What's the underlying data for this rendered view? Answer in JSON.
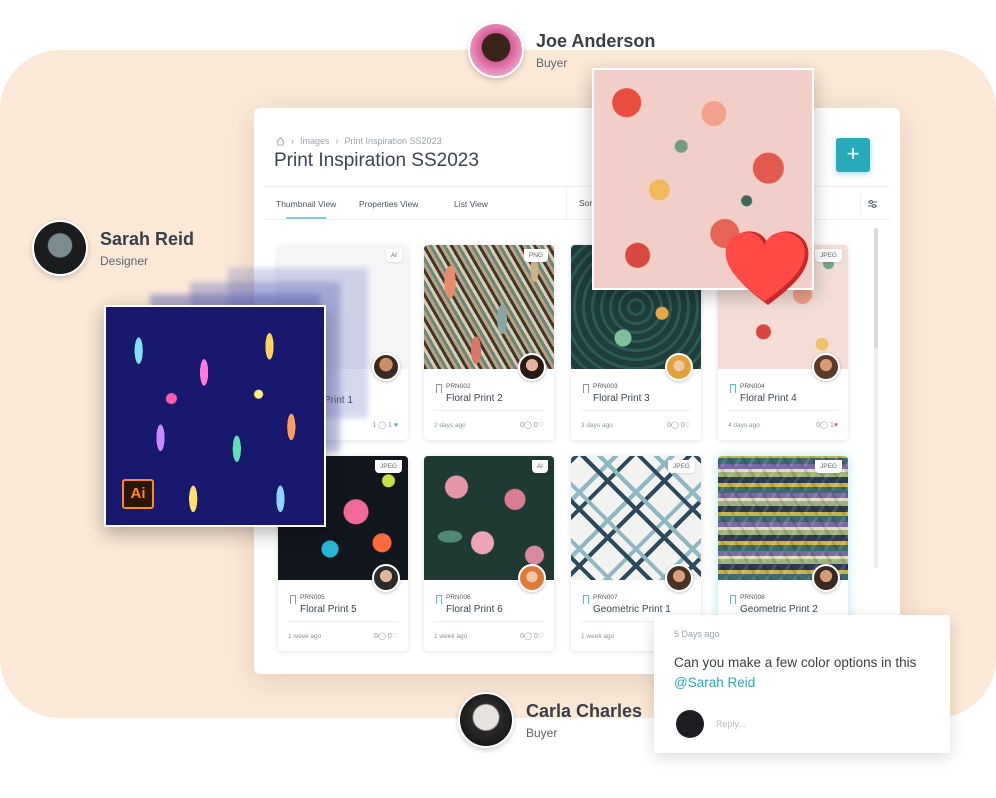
{
  "app": {
    "breadcrumb": [
      "Images",
      "Print Inspiration SS2023"
    ],
    "title": "Print Inspiration SS2023",
    "tabs": [
      "Thumbnail View",
      "Properties View",
      "List View"
    ],
    "sort_label": "Sort By"
  },
  "cards": [
    {
      "badge": "AI",
      "code": "",
      "title": "Print 1",
      "age": "",
      "comments": "1",
      "likes": "1"
    },
    {
      "badge": "PNG",
      "code": "PRN002",
      "title": "Floral Print 2",
      "age": "2 days ago",
      "comments": "0",
      "likes": "0"
    },
    {
      "badge": "",
      "code": "PRN003",
      "title": "Floral Print 3",
      "age": "3 days ago",
      "comments": "0",
      "likes": "0"
    },
    {
      "badge": "JPEG",
      "code": "PRN004",
      "title": "Floral Print 4",
      "age": "4 days ago",
      "comments": "0",
      "likes": "1"
    },
    {
      "badge": "JPEG",
      "code": "PRN005",
      "title": "Floral Print 5",
      "age": "1 week ago",
      "comments": "0",
      "likes": "0"
    },
    {
      "badge": "AI",
      "code": "PRN006",
      "title": "Floral Print 6",
      "age": "1 week ago",
      "comments": "0",
      "likes": "0"
    },
    {
      "badge": "JPEG",
      "code": "PRN007",
      "title": "Geometric Print 1",
      "age": "1 week ago",
      "comments": "0",
      "likes": "0"
    },
    {
      "badge": "JPEG",
      "code": "PRN008",
      "title": "Geometric Print 2",
      "age": "",
      "comments": "",
      "likes": ""
    }
  ],
  "people": {
    "joe": {
      "name": "Joe Anderson",
      "role": "Buyer"
    },
    "sarah": {
      "name": "Sarah Reid",
      "role": "Designer"
    },
    "carla": {
      "name": "Carla Charles",
      "role": "Buyer"
    }
  },
  "comment": {
    "time": "5 Days ago",
    "text": "Can you make a few color options in this",
    "mention": "@Sarah Reid",
    "reply_placeholder": "Reply..."
  },
  "illustrator_badge": "Ai",
  "colors": {
    "accent": "#27aab9",
    "backdrop": "#fbe8d6",
    "heart": "#ff4a45"
  }
}
